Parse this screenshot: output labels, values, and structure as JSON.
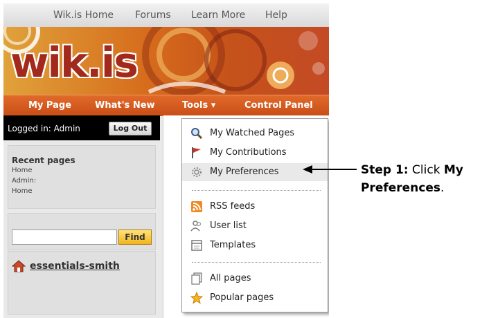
{
  "top_nav": [
    "Wik.is Home",
    "Forums",
    "Learn More",
    "Help"
  ],
  "logo_text": "wik.is",
  "main_nav": {
    "my_page": "My Page",
    "whats_new": "What's New",
    "tools": "Tools ▾",
    "control_panel": "Control Panel"
  },
  "login": {
    "status": "Logged in: Admin",
    "logout_label": "Log Out"
  },
  "sidebar": {
    "recent_title": "Recent pages",
    "recent_items": [
      "Home",
      "Admin:",
      "Home"
    ],
    "find_label": "Find",
    "home_link": "essentials-smith"
  },
  "tools_menu": {
    "items": [
      {
        "label": "My Watched Pages",
        "icon": "magnifier-icon"
      },
      {
        "label": "My Contributions",
        "icon": "flag-icon"
      },
      {
        "label": "My Preferences",
        "icon": "gear-icon",
        "highlighted": true
      },
      {
        "label": "RSS feeds",
        "icon": "rss-icon"
      },
      {
        "label": "User list",
        "icon": "users-icon"
      },
      {
        "label": "Templates",
        "icon": "template-icon"
      },
      {
        "label": "All pages",
        "icon": "pages-icon"
      },
      {
        "label": "Popular pages",
        "icon": "star-icon"
      }
    ]
  },
  "callout": {
    "step": "Step 1:",
    "text": " Click ",
    "target_a": "My",
    "target_b": "Preferences",
    "end": "."
  },
  "colors": {
    "nav_orange": "#d8581f",
    "find_yellow": "#f2b51c",
    "logo_red": "#a2291b"
  }
}
